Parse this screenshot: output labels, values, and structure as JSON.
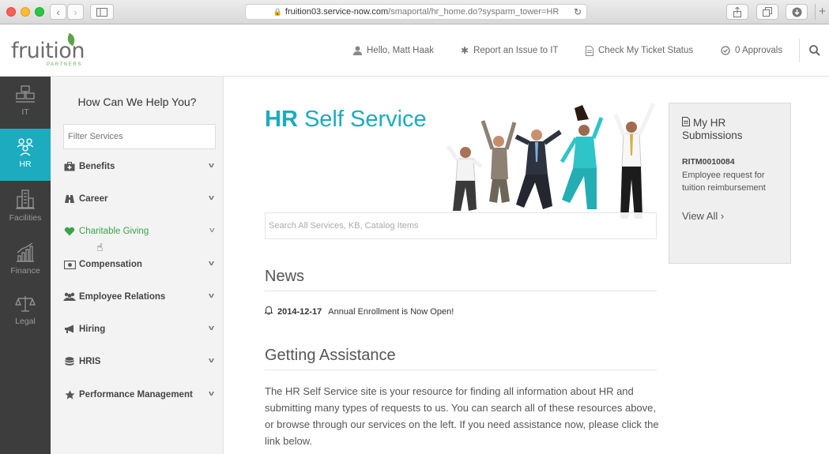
{
  "browser": {
    "url_host": "fruition03.service-now.com",
    "url_path": "/smaportal/hr_home.do?sysparm_tower=HR"
  },
  "header": {
    "logo_word": "fruition",
    "logo_sub": "PARTNERS",
    "greeting": "Hello, Matt Haak",
    "report_issue": "Report an Issue to IT",
    "ticket_status": "Check My Ticket Status",
    "approvals": "0 Approvals"
  },
  "rail": {
    "items": [
      {
        "label": "IT",
        "icon": "building-icon"
      },
      {
        "label": "HR",
        "icon": "people-icon"
      },
      {
        "label": "Facilities",
        "icon": "city-icon"
      },
      {
        "label": "Finance",
        "icon": "chart-icon"
      },
      {
        "label": "Legal",
        "icon": "scales-icon"
      }
    ],
    "active": "HR"
  },
  "services": {
    "title": "How Can We Help You?",
    "filter_placeholder": "Filter Services",
    "items": [
      {
        "label": "Benefits",
        "icon": "medkit-icon"
      },
      {
        "label": "Career",
        "icon": "binoculars-icon"
      },
      {
        "label": "Charitable Giving",
        "icon": "heart-icon"
      },
      {
        "label": "Compensation",
        "icon": "money-icon"
      },
      {
        "label": "Employee Relations",
        "icon": "users-icon"
      },
      {
        "label": "Hiring",
        "icon": "bullhorn-icon"
      },
      {
        "label": "HRIS",
        "icon": "database-icon"
      },
      {
        "label": "Performance Management",
        "icon": "star-icon"
      }
    ],
    "highlighted": "Charitable Giving"
  },
  "main": {
    "title_bold": "HR",
    "title_rest": " Self Service",
    "search_placeholder": "Search All Services, KB, Catalog Items",
    "news_heading": "News",
    "news_items": [
      {
        "date": "2014-12-17",
        "text": "Annual Enrollment is Now Open!"
      }
    ],
    "assistance_heading": "Getting Assistance",
    "assistance_text": "The HR Self Service site is your resource for finding all information about HR and submitting many types of requests to us. You can search all of these resources above, or browse through our services on the left. If you need assistance now, please click the link below."
  },
  "submissions": {
    "title": "My HR Submissions",
    "item_id": "RITM0010084",
    "item_desc": "Employee request for tuition reimbursement",
    "view_all": "View All"
  },
  "colors": {
    "accent": "#1cabbf",
    "rail_bg": "#3d3d3d",
    "highlight_green": "#3aa44a"
  }
}
